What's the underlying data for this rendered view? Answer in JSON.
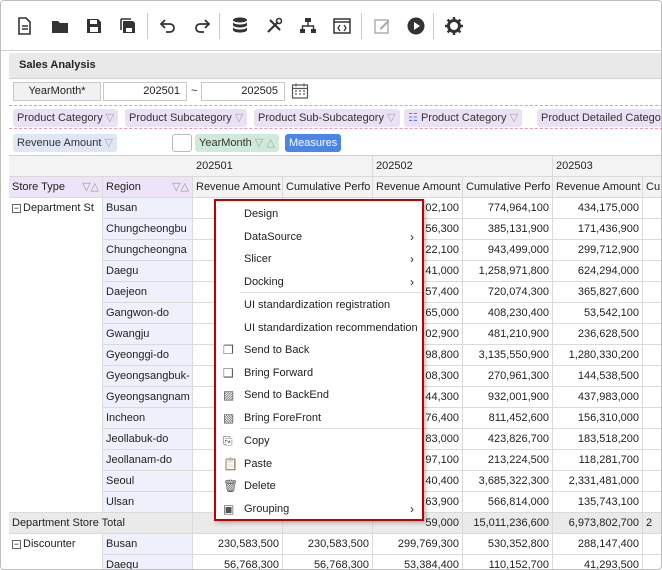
{
  "toolbar": {
    "icons": [
      "new-file-icon",
      "open-folder-icon",
      "save-icon",
      "save-all-icon",
      "undo-icon",
      "redo-icon",
      "database-icon",
      "tools-icon",
      "hierarchy-icon",
      "code-icon",
      "edit-icon",
      "run-icon",
      "settings-icon"
    ]
  },
  "report": {
    "title": "Sales Analysis"
  },
  "params": {
    "label": "YearMonth*",
    "from": "202501",
    "tilde": "~",
    "to": "202505"
  },
  "row_dimensions": [
    "Product Category",
    "Product Subcategory",
    "Product Sub-Subcategory",
    "Product Category",
    "Product Detailed Catego"
  ],
  "measure_zone": {
    "field": "Revenue Amount",
    "col_field": "YearMonth",
    "measures": "Measures"
  },
  "grid": {
    "periods": [
      "202501",
      "202502",
      "202503"
    ],
    "col_headers": [
      "Store Type",
      "Region",
      "Revenue Amount",
      "Cumulative Perfo",
      "Revenue Amount",
      "Cumulative Perfo",
      "Revenue Amount",
      "Cu"
    ],
    "group1": "Department St",
    "regions": [
      "Busan",
      "Chungcheongbu",
      "Chungcheongna",
      "Daegu",
      "Daejeon",
      "Gangwon-do",
      "Gwangju",
      "Gyeonggi-do",
      "Gyeongsangbuk-",
      "Gyeongsangnam",
      "Incheon",
      "Jeollabuk-do",
      "Jeollanam-do",
      "Seoul",
      "Ulsan"
    ],
    "r2_partial": [
      "02,100",
      "56,300",
      "22,100",
      "41,000",
      "57,400",
      "65,000",
      "02,900",
      "98,800",
      "08,300",
      "44,300",
      "76,400",
      "83,000",
      "97,100",
      "40,400",
      "63,900"
    ],
    "r2_cum": [
      "774,964,100",
      "385,131,900",
      "943,499,000",
      "1,258,971,800",
      "720,074,300",
      "408,230,400",
      "481,210,900",
      "3,135,550,900",
      "270,961,300",
      "932,001,900",
      "811,452,600",
      "423,826,700",
      "213,224,500",
      "3,685,322,300",
      "566,814,000"
    ],
    "r3": [
      "434,175,000",
      "171,436,900",
      "299,712,900",
      "624,294,000",
      "365,827,600",
      "53,542,100",
      "236,628,500",
      "1,280,330,200",
      "144,538,500",
      "437,983,000",
      "156,310,000",
      "183,518,200",
      "118,281,700",
      "2,331,481,000",
      "135,743,100"
    ],
    "total": {
      "label": "Department Store Total",
      "p2": "59,000",
      "c2": "15,011,236,600",
      "r3": "6,973,802,700",
      "c3": "2"
    },
    "group2": "Discounter",
    "disc_rows": [
      {
        "region": "Busan",
        "r1": "230,583,500",
        "c1": "230,583,500",
        "r2": "299,769,300",
        "c2": "530,352,800",
        "r3": "288,147,400"
      },
      {
        "region": "Daegu",
        "r1": "56,768,300",
        "c1": "56,768,300",
        "r2": "53,384,400",
        "c2": "110,152,700",
        "r3": "41,293,500"
      }
    ]
  },
  "context_menu": {
    "items": [
      {
        "label": "Design",
        "arrow": "",
        "icon": ""
      },
      {
        "label": "DataSource",
        "arrow": "›",
        "icon": ""
      },
      {
        "label": "Slicer",
        "arrow": "›",
        "icon": ""
      },
      {
        "label": "Docking",
        "arrow": "›",
        "icon": ""
      },
      {
        "label": "UI standardization registration",
        "arrow": "",
        "icon": ""
      },
      {
        "label": "UI standardization recommendation",
        "arrow": "",
        "icon": ""
      },
      {
        "label": "Send to Back",
        "arrow": "",
        "icon": "send-to-back-icon"
      },
      {
        "label": "Bring Forward",
        "arrow": "",
        "icon": "bring-forward-icon"
      },
      {
        "label": "Send to BackEnd",
        "arrow": "",
        "icon": "send-to-backend-icon"
      },
      {
        "label": "Bring ForeFront",
        "arrow": "",
        "icon": "bring-forefront-icon"
      },
      {
        "label": "Copy",
        "arrow": "",
        "icon": "copy-icon"
      },
      {
        "label": "Paste",
        "arrow": "",
        "icon": "paste-icon"
      },
      {
        "label": "Delete",
        "arrow": "",
        "icon": "delete-icon"
      },
      {
        "label": "Grouping",
        "arrow": "›",
        "icon": "grouping-icon"
      }
    ]
  },
  "colors": {
    "menu_border": "#c00000",
    "measures_pill": "#4a86e8",
    "drop_zone_border": "#e49ab6"
  }
}
